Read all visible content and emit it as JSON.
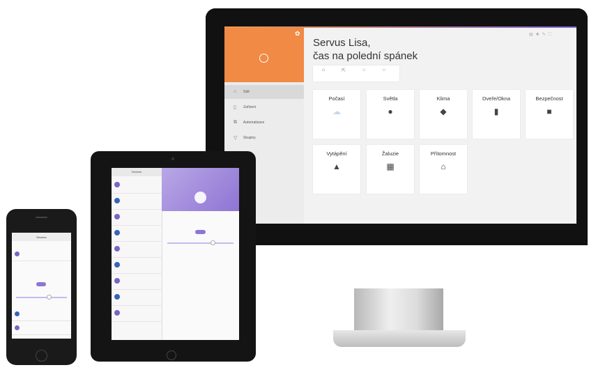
{
  "desktop": {
    "greeting_line1": "Servus Lisa,",
    "greeting_line2": "čas na polední spánek",
    "toolbar_icons": [
      "grid-icon",
      "plus-icon",
      "pencil-icon",
      "fullscreen-icon"
    ],
    "sidebar": {
      "items": [
        {
          "label": "Sítě",
          "icon": "home-icon",
          "active": true
        },
        {
          "label": "Zařízení",
          "icon": "device-icon",
          "active": false
        },
        {
          "label": "Automatizace",
          "icon": "automation-icon",
          "active": false
        },
        {
          "label": "Skupiny",
          "icon": "filter-icon",
          "active": false
        }
      ]
    },
    "modes": [
      {
        "icon": "home-icon",
        "selected": true
      },
      {
        "icon": "away-icon",
        "selected": false
      },
      {
        "icon": "house-icon",
        "selected": false
      },
      {
        "icon": "sun-icon",
        "selected": false
      }
    ],
    "tiles": [
      {
        "title": "Počasí",
        "icon": "cloud-rain-icon"
      },
      {
        "title": "Světla",
        "icon": "bulb-icon"
      },
      {
        "title": "Klima",
        "icon": "leaf-icon"
      },
      {
        "title": "Dveře/Okna",
        "icon": "door-icon"
      },
      {
        "title": "Bezpečnost",
        "icon": "lock-icon"
      },
      {
        "title": "Vytápění",
        "icon": "thermometer-icon"
      },
      {
        "title": "Žaluzie",
        "icon": "blinds-icon"
      },
      {
        "title": "Přítomnost",
        "icon": "presence-icon"
      }
    ]
  },
  "tablet": {
    "title": "Devices"
  },
  "phone": {
    "title": "Devices"
  },
  "colors": {
    "accent_orange": "#f08a45",
    "accent_purple": "#8e75d4"
  }
}
